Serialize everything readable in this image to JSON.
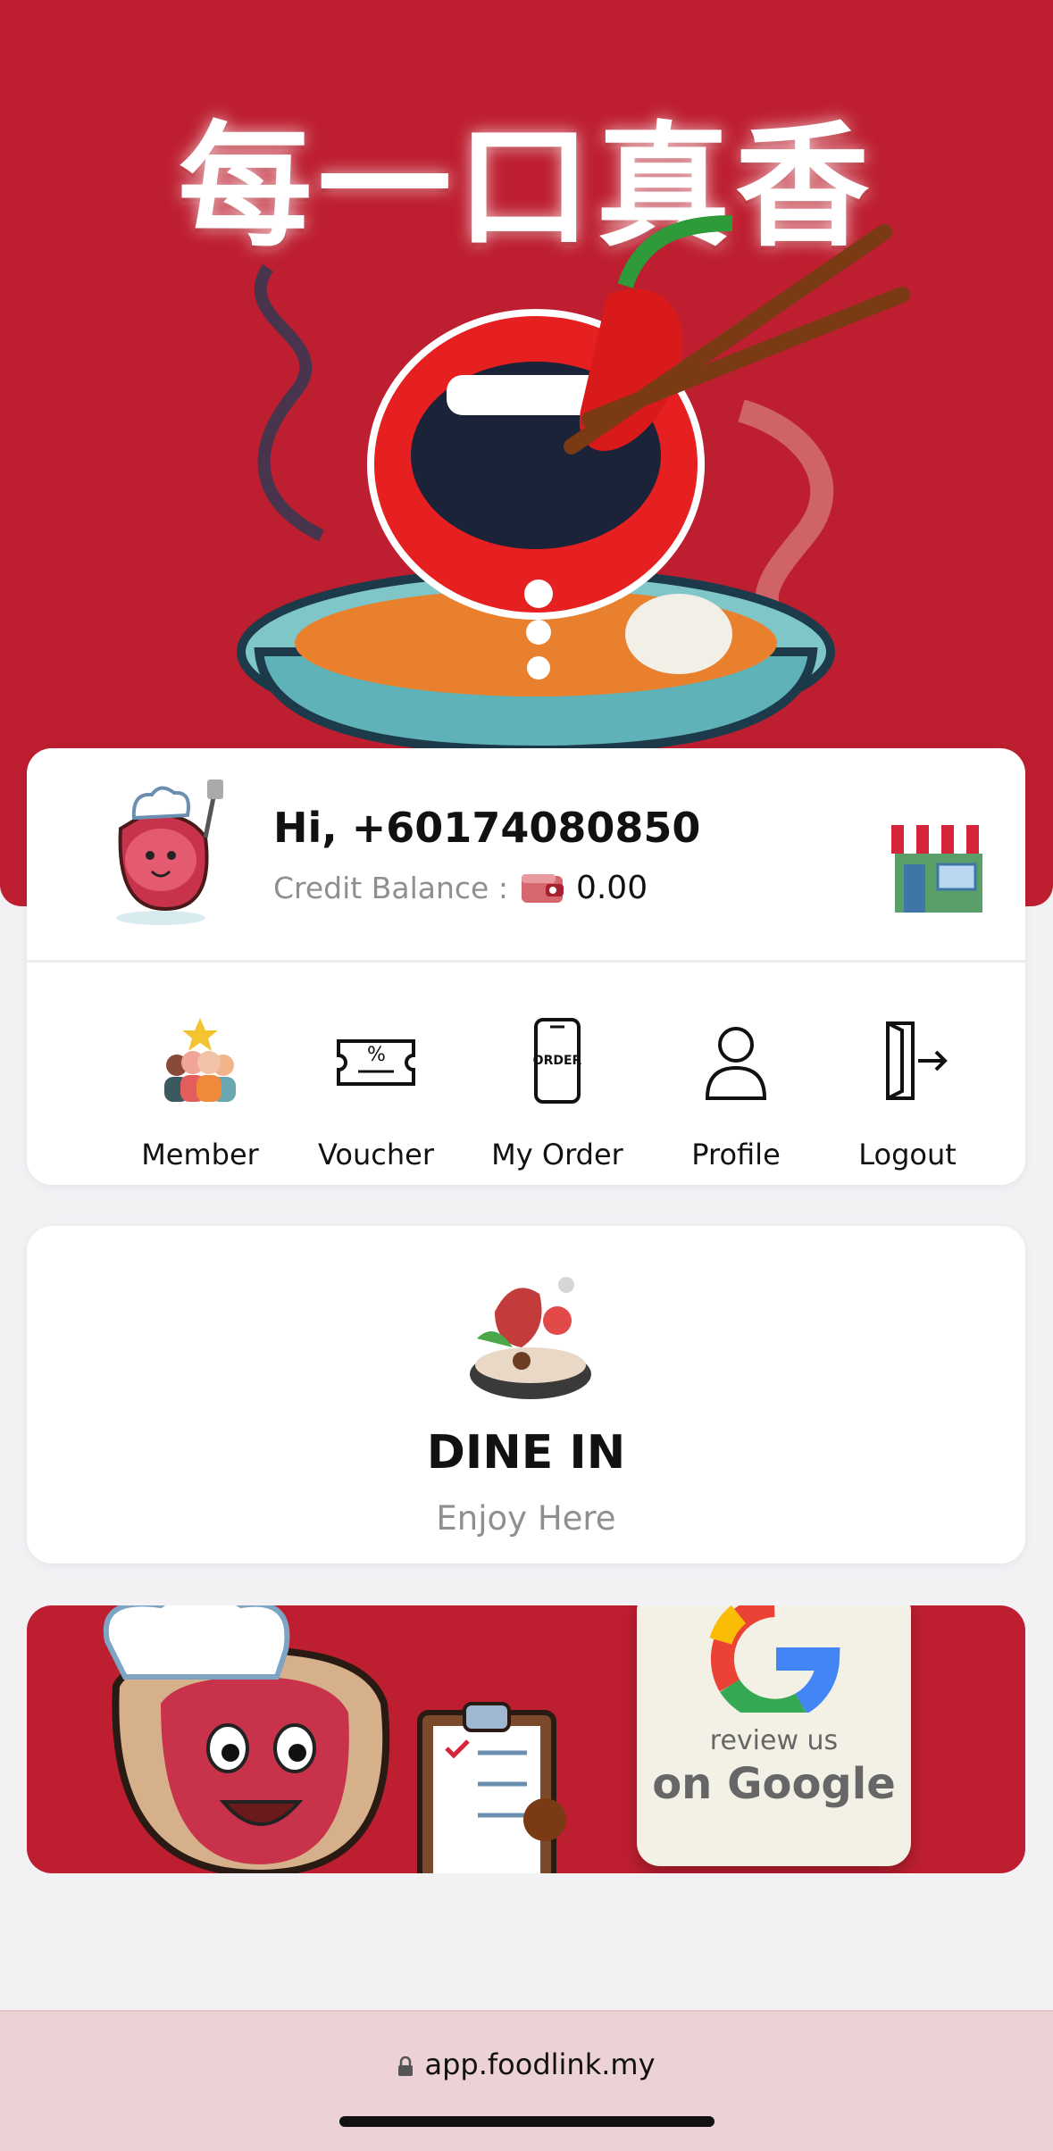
{
  "hero": {
    "title": "每一口真香"
  },
  "user": {
    "greeting": "Hi, +60174080850",
    "credit_label": "Credit Balance :",
    "credit_value": "0.00"
  },
  "menu": {
    "items": [
      {
        "label": "Member",
        "icon": "member-icon"
      },
      {
        "label": "Voucher",
        "icon": "voucher-icon"
      },
      {
        "label": "My Order",
        "icon": "order-icon"
      },
      {
        "label": "Profile",
        "icon": "profile-icon"
      },
      {
        "label": "Logout",
        "icon": "logout-icon"
      }
    ],
    "order_icon_text": "ORDER"
  },
  "dine_in": {
    "title": "DINE IN",
    "subtitle": "Enjoy Here"
  },
  "banner": {
    "review_text": "review us",
    "google_text": "on Google"
  },
  "browser": {
    "url": "app.foodlink.my"
  },
  "colors": {
    "brand_red": "#bd1f30",
    "background": "#f2f1f4",
    "url_bar": "#ecd2d6"
  }
}
